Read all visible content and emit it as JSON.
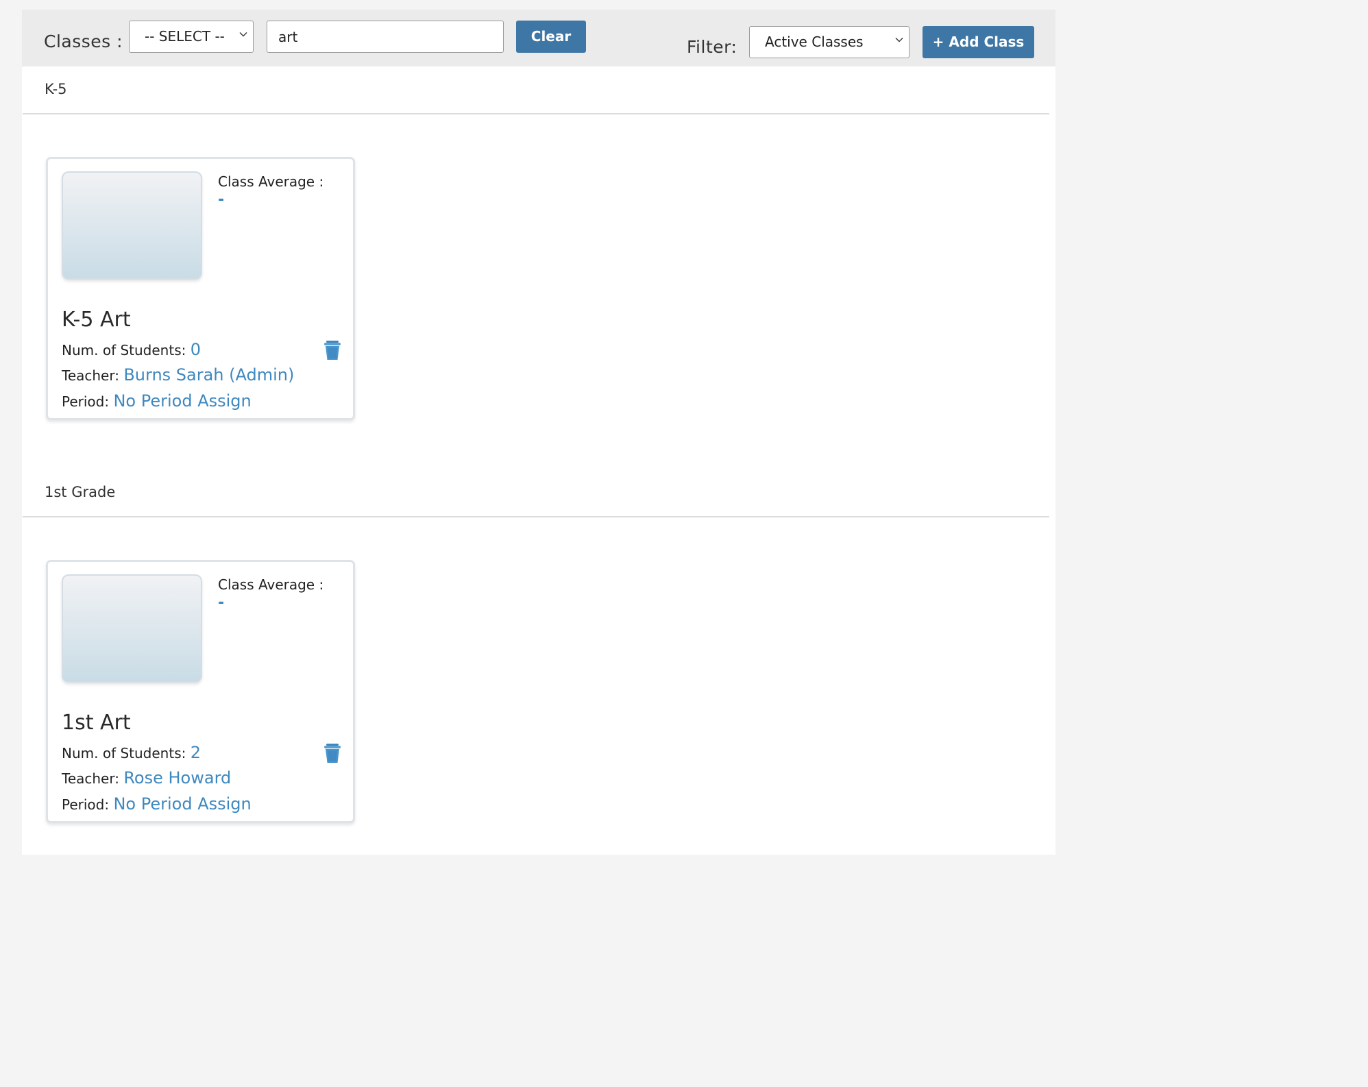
{
  "toolbar": {
    "classes_label": "Classes :",
    "class_select_value": "-- SELECT --",
    "search_value": "art",
    "clear_label": "Clear",
    "filter_label": "Filter:",
    "filter_value": "Active Classes",
    "add_class_label": "+ Add Class"
  },
  "groups": [
    {
      "title": "K-5",
      "card": {
        "avg_label": "Class Average :",
        "avg_value": "-",
        "name": "K-5 Art",
        "students_label": "Num. of Students:",
        "students_value": "0",
        "teacher_label": "Teacher:",
        "teacher_value": "Burns Sarah (Admin)",
        "period_label": "Period:",
        "period_value": "No Period Assign"
      }
    },
    {
      "title": "1st Grade",
      "card": {
        "avg_label": "Class Average :",
        "avg_value": "-",
        "name": "1st Art",
        "students_label": "Num. of Students:",
        "students_value": "2",
        "teacher_label": "Teacher:",
        "teacher_value": "Rose Howard",
        "period_label": "Period:",
        "period_value": "No Period Assign"
      }
    }
  ],
  "colors": {
    "accent": "#3e77a5",
    "link": "#3e88bf",
    "toolbar_bg": "#ebebeb"
  },
  "icons": {
    "select_chevron": "chevron-down-icon",
    "delete": "trash-icon"
  }
}
